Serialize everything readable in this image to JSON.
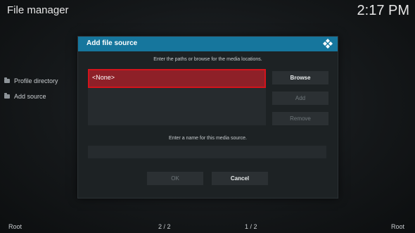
{
  "header": {
    "title": "File manager",
    "clock": "2:17 PM"
  },
  "sidebar": {
    "items": [
      {
        "label": "Profile directory"
      },
      {
        "label": "Add source"
      }
    ]
  },
  "footer": {
    "left": "Root",
    "mid_left": "2 / 2",
    "mid_right": "1 / 2",
    "right": "Root"
  },
  "dialog": {
    "title": "Add file source",
    "instruction_paths": "Enter the paths or browse for the media locations.",
    "path_items": [
      {
        "label": "<None>"
      }
    ],
    "buttons": {
      "browse": "Browse",
      "add": "Add",
      "remove": "Remove",
      "ok": "OK",
      "cancel": "Cancel"
    },
    "instruction_name": "Enter a name for this media source.",
    "name_value": ""
  },
  "colors": {
    "accent": "#16769d",
    "focus": "#d3141c"
  },
  "icons": {
    "dialog_logo": "kodi-logo-icon",
    "folder": "folder-icon"
  }
}
